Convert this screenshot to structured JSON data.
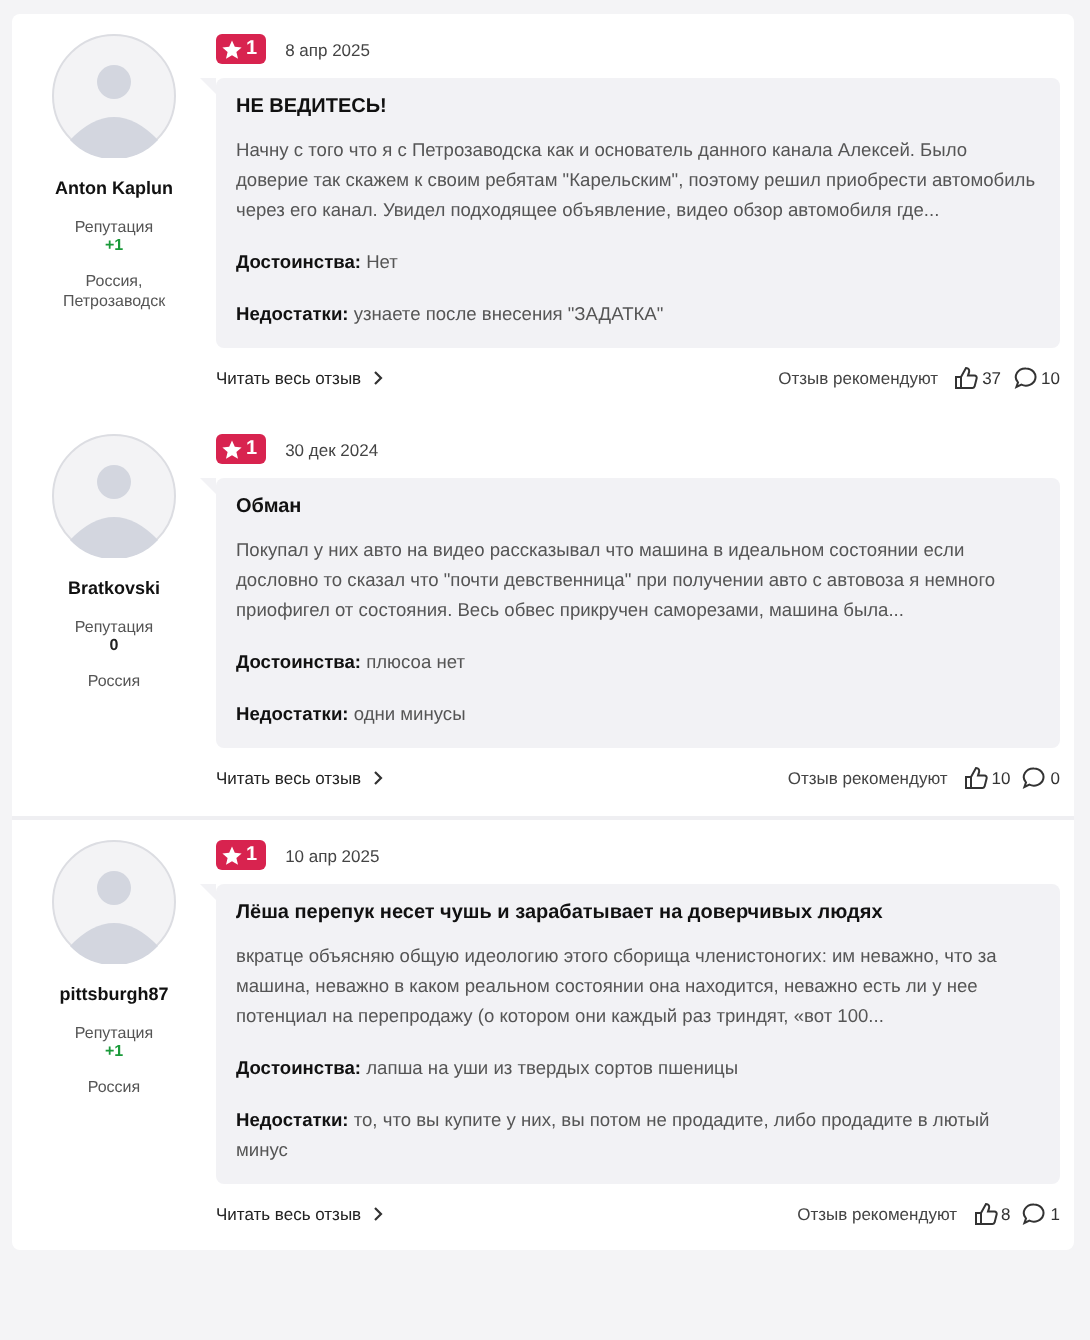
{
  "reviews": [
    {
      "author": "Anton Kaplun",
      "reputation_label": "Репутация",
      "reputation": "+1",
      "reputation_positive": true,
      "location": "Россия, Петрозаводск",
      "rating": "1",
      "date": "8 апр 2025",
      "title": "НЕ ВЕДИТЕСЬ!",
      "text": "Начну с того что я с Петрозаводска как и основатель данного канала Алексей. Было доверие так скажем к своим ребятам \"Карельским\", поэтому решил приобрести автомобиль через его канал. Увидел подходящее объявление, видео обзор автомобиля где...",
      "pros_label": "Достоинства:",
      "pros": "Нет",
      "cons_label": "Недостатки:",
      "cons": "узнаете после внесения \"ЗАДАТКА\"",
      "read_more": "Читать весь отзыв",
      "recommend_label": "Отзыв рекомендуют",
      "likes": "37",
      "comments": "10"
    },
    {
      "author": "Bratkovski",
      "reputation_label": "Репутация",
      "reputation": "0",
      "reputation_positive": false,
      "location": "Россия",
      "rating": "1",
      "date": "30 дек 2024",
      "title": "Обман",
      "text": "Покупал у них авто на видео рассказывал что машина в идеальном состоянии если дословно то сказал что \"почти девственница\" при получении авто с автовоза я немного приофигел от состояния. Весь обвес прикручен саморезами, машина была...",
      "pros_label": "Достоинства:",
      "pros": "плюсоа нет",
      "cons_label": "Недостатки:",
      "cons": "одни минусы",
      "read_more": "Читать весь отзыв",
      "recommend_label": "Отзыв рекомендуют",
      "likes": "10",
      "comments": "0"
    },
    {
      "author": "pittsburgh87",
      "reputation_label": "Репутация",
      "reputation": "+1",
      "reputation_positive": true,
      "location": "Россия",
      "rating": "1",
      "date": "10 апр 2025",
      "title": "Лёша перепук несет чушь и зарабатывает на доверчивых людях",
      "text": "вкратце объясняю общую идеологию этого сборища членистоногих: им неважно, что за машина, неважно в каком реальном состоянии она находится, неважно есть ли у нее потенциал на перепродажу (о котором они каждый раз триндят, «вот 100...",
      "pros_label": "Достоинства:",
      "pros": "лапша на уши из твердых сортов пшеницы",
      "cons_label": "Недостатки:",
      "cons": "то, что вы купите у них, вы потом не продадите, либо продадите в лютый минус",
      "read_more": "Читать весь отзыв",
      "recommend_label": "Отзыв рекомендуют",
      "likes": "8",
      "comments": "1"
    }
  ]
}
